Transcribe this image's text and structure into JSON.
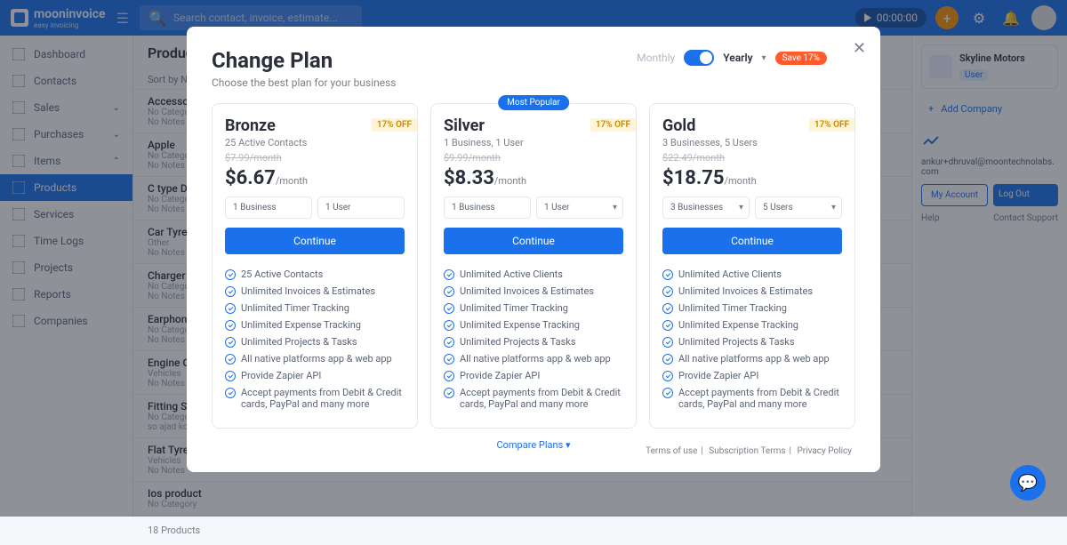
{
  "app": {
    "name": "mooninvoice",
    "tagline": "easy invoicing"
  },
  "search": {
    "placeholder": "Search contact, invoice, estimate..."
  },
  "timer": {
    "value": "00:00:00"
  },
  "nav": [
    {
      "label": "Dashboard"
    },
    {
      "label": "Contacts"
    },
    {
      "label": "Sales",
      "chev": true
    },
    {
      "label": "Purchases",
      "chev": true
    },
    {
      "label": "Items",
      "chev": true,
      "expanded": true
    },
    {
      "label": "Products",
      "active": true
    },
    {
      "label": "Services"
    },
    {
      "label": "Time Logs"
    },
    {
      "label": "Projects"
    },
    {
      "label": "Reports"
    },
    {
      "label": "Companies"
    }
  ],
  "page": {
    "title": "Products",
    "sort": "Sort by Name",
    "count": "18 Products"
  },
  "products": [
    {
      "n": "Accessories",
      "c": "No Category",
      "no": "No Notes"
    },
    {
      "n": "Apple",
      "c": "No Category",
      "no": "No Notes"
    },
    {
      "n": "C type Data C",
      "c": "No Category",
      "no": "No Notes"
    },
    {
      "n": "Car Tyres",
      "c": "Other",
      "no": "No Notes"
    },
    {
      "n": "Charger",
      "c": "No Category",
      "no": "No Notes"
    },
    {
      "n": "Earphones",
      "c": "No Category",
      "no": "No Notes"
    },
    {
      "n": "Engine Oil",
      "c": "Vehicles",
      "no": "No Notes"
    },
    {
      "n": "Fitting Servic",
      "c": "No Category",
      "no": "so ajad kosh"
    },
    {
      "n": "Flat Tyres",
      "c": "Vehicles",
      "no": "No Notes"
    },
    {
      "n": "Ios product",
      "c": "No Category",
      "no": ""
    }
  ],
  "company": {
    "name": "Skyline Motors",
    "role": "User",
    "add": "Add Company",
    "email": "ankur+dhruval@moontechnolabs.com",
    "myacct": "My Account",
    "logout": "Log Out",
    "help": "Help",
    "support": "Contact Support"
  },
  "modal": {
    "title": "Change Plan",
    "sub": "Choose the best plan for your business",
    "monthly": "Monthly",
    "yearly": "Yearly",
    "save": "Save 17%",
    "close": "✕",
    "compare": "Compare Plans",
    "footer": {
      "terms": "Terms of use",
      "sub": "Subscription Terms",
      "priv": "Privacy Policy"
    },
    "plans": [
      {
        "name": "Bronze",
        "desc": "25 Active Contacts",
        "off": "17% OFF",
        "old": "$7.99/month",
        "price": "$6.67",
        "per": "/month",
        "sel1": "1 Business",
        "sel2": "1 User",
        "sel1dd": false,
        "sel2dd": false,
        "btn": "Continue",
        "popular": false,
        "features": [
          "25 Active Contacts",
          "Unlimited Invoices & Estimates",
          "Unlimited Timer Tracking",
          "Unlimited Expense Tracking",
          "Unlimited Projects & Tasks",
          "All native platforms app & web app",
          "Provide Zapier API",
          "Accept payments from Debit & Credit cards, PayPal and many more"
        ]
      },
      {
        "name": "Silver",
        "desc": "1 Business, 1 User",
        "off": "17% OFF",
        "old": "$9.99/month",
        "price": "$8.33",
        "per": "/month",
        "sel1": "1 Business",
        "sel2": "1 User",
        "sel1dd": false,
        "sel2dd": true,
        "btn": "Continue",
        "popular": true,
        "poplabel": "Most Popular",
        "features": [
          "Unlimited Active Clients",
          "Unlimited Invoices & Estimates",
          "Unlimited Timer Tracking",
          "Unlimited Expense Tracking",
          "Unlimited Projects & Tasks",
          "All native platforms app & web app",
          "Provide Zapier API",
          "Accept payments from Debit & Credit cards, PayPal and many more"
        ]
      },
      {
        "name": "Gold",
        "desc": "3 Businesses, 5 Users",
        "off": "17% OFF",
        "old": "$22.49/month",
        "price": "$18.75",
        "per": "/month",
        "sel1": "3  Businesses",
        "sel2": "5 Users",
        "sel1dd": true,
        "sel2dd": true,
        "btn": "Continue",
        "popular": false,
        "features": [
          "Unlimited Active Clients",
          "Unlimited Invoices & Estimates",
          "Unlimited Timer Tracking",
          "Unlimited Expense Tracking",
          "Unlimited Projects & Tasks",
          "All native platforms app & web app",
          "Provide Zapier API",
          "Accept payments from Debit & Credit cards, PayPal and many more"
        ]
      }
    ]
  }
}
